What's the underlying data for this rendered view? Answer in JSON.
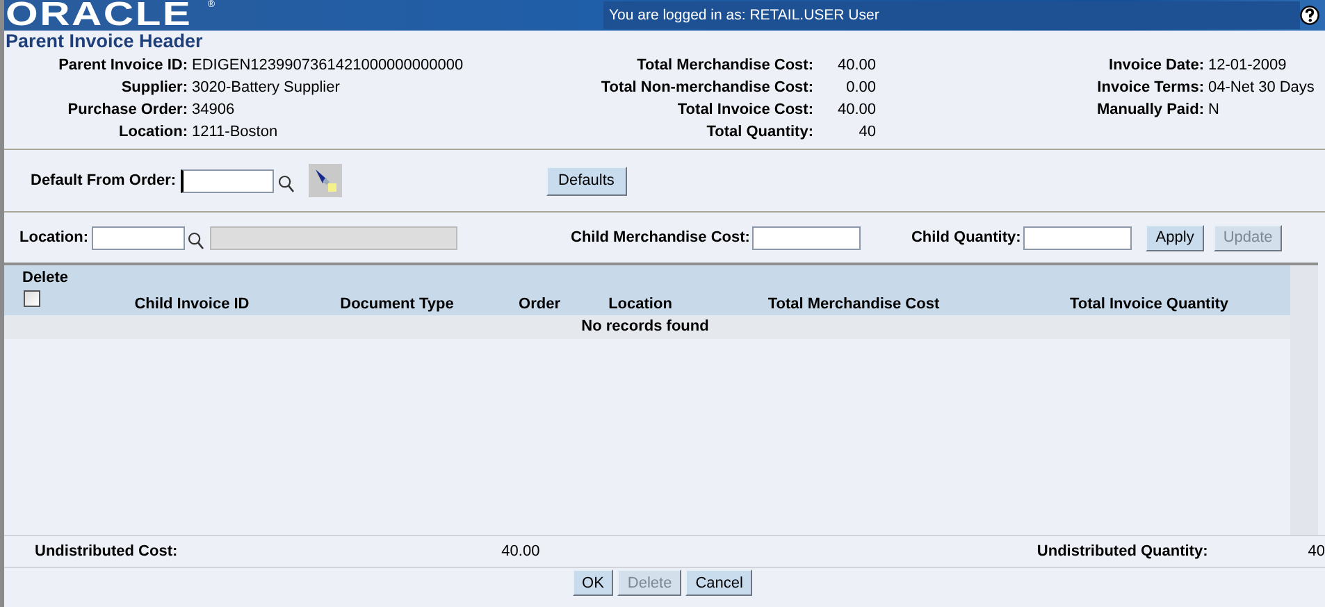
{
  "header": {
    "logo": "ORACLE",
    "logo_mark": "®",
    "login_text": "You are logged in as: RETAIL.USER User"
  },
  "section_title": "Parent Invoice Header",
  "info_columns": [
    [
      {
        "label": "Parent Invoice ID:",
        "value": "EDIGEN1239907361421000000000000"
      },
      {
        "label": "Supplier:",
        "value": "3020-Battery Supplier"
      },
      {
        "label": "Purchase Order:",
        "value": "34906"
      },
      {
        "label": "Location:",
        "value": "1211-Boston"
      }
    ],
    [
      {
        "label": "Total Merchandise Cost:",
        "value": "40.00"
      },
      {
        "label": "Total Non-merchandise Cost:",
        "value": "0.00"
      },
      {
        "label": "Total Invoice Cost:",
        "value": "40.00"
      },
      {
        "label": "Total Quantity:",
        "value": "40"
      }
    ],
    [
      {
        "label": "Invoice Date:",
        "value": "12-01-2009"
      },
      {
        "label": "Invoice Terms:",
        "value": "04-Net 30 Days"
      },
      {
        "label": "Manually Paid:",
        "value": "N"
      }
    ]
  ],
  "default_from_order": {
    "label": "Default From Order:",
    "button": "Defaults"
  },
  "filters": {
    "location_label": "Location:",
    "child_cost_label": "Child Merchandise Cost:",
    "child_quantity_label": "Child Quantity:",
    "buttons": [
      {
        "label": "Apply",
        "disabled": false
      },
      {
        "label": "Update",
        "disabled": true
      }
    ]
  },
  "table": {
    "delete_label": "Delete",
    "select_all_checked": false,
    "columns": [
      "Child Invoice ID",
      "Document Type",
      "Order",
      "Location",
      "Total Merchandise Cost",
      "Total Invoice Quantity"
    ],
    "empty_message": "No records found"
  },
  "footer": {
    "cost_label": "Undistributed Cost:",
    "cost_value": "40.00",
    "quantity_label": "Undistributed Quantity:",
    "quantity_value": "40"
  },
  "buttons": [
    {
      "label": "OK",
      "disabled": false
    },
    {
      "label": "Delete",
      "disabled": true
    },
    {
      "label": "Cancel",
      "disabled": false
    }
  ]
}
